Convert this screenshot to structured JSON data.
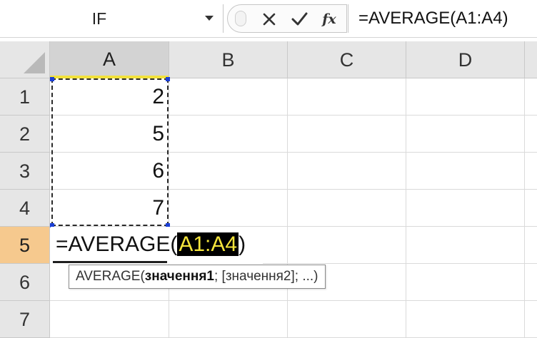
{
  "formula_bar": {
    "name_box": "IF",
    "insert_function_label": "fx",
    "formula": "=AVERAGE(A1:A4)"
  },
  "sheet": {
    "columns": [
      "A",
      "B",
      "C",
      "D"
    ],
    "rows": [
      "1",
      "2",
      "3",
      "4",
      "5",
      "6",
      "7"
    ],
    "column_a_values": [
      "2",
      "5",
      "6",
      "7"
    ],
    "active_column": "A",
    "active_row": "5"
  },
  "edit_cell": {
    "prefix": "=AVERAGE(",
    "argument": "A1:A4",
    "suffix": ")"
  },
  "tooltip": {
    "function": "AVERAGE(",
    "arg1": "значення1",
    "rest": "; [значення2]; ...)"
  },
  "colors": {
    "active_row_header": "#f6c98e",
    "active_col_underline": "#f2e13a",
    "argument_highlight_bg": "#000000",
    "argument_highlight_fg": "#f5e53c",
    "range_handle": "#1a3fd6"
  }
}
